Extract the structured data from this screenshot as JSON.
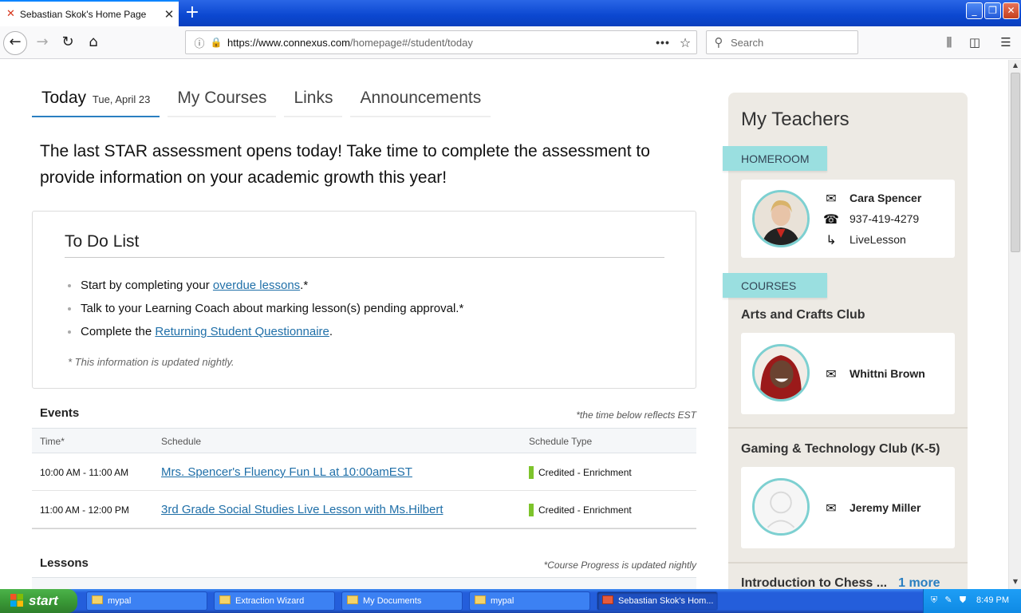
{
  "browser": {
    "tab_title": "Sebastian Skok's Home Page",
    "tab_close": "✕",
    "new_tab": "+",
    "url_host": "https://www.connexus.com",
    "url_path": "/homepage#/student/today",
    "url_menu": "•••",
    "search_placeholder": "Search",
    "icons": [
      "back-icon",
      "forward-icon",
      "reload-icon",
      "home-icon",
      "info-icon",
      "lock-icon",
      "star-icon",
      "search-icon",
      "library-icon",
      "sidebar-icon",
      "menu-icon"
    ]
  },
  "page_tabs": [
    {
      "label": "Today",
      "date": "Tue, April 23"
    },
    {
      "label": "My Courses"
    },
    {
      "label": "Links"
    },
    {
      "label": "Announcements"
    }
  ],
  "announcement": "The last STAR assessment opens today! Take time to complete the assessment to provide information on your academic growth this year!",
  "todo": {
    "title": "To Do List",
    "item1_prefix": "Start by completing your ",
    "item1_link": "overdue lessons",
    "item1_suffix": ".*",
    "item2": "Talk to your Learning Coach about marking lesson(s) pending approval.*",
    "item3_prefix": "Complete the ",
    "item3_link": "Returning Student Questionnaire",
    "item3_suffix": ".",
    "note": "* This information is updated nightly."
  },
  "events": {
    "title": "Events",
    "note": "*the time below reflects EST",
    "columns": [
      "Time*",
      "Schedule",
      "Schedule Type"
    ],
    "rows": [
      {
        "time": "10:00 AM - 11:00 AM",
        "schedule": "Mrs. Spencer's Fluency Fun LL at 10:00amEST",
        "type": "Credited - Enrichment"
      },
      {
        "time": "11:00 AM - 12:00 PM",
        "schedule": "3rd Grade Social Studies Live Lesson with Ms.Hilbert",
        "type": "Credited - Enrichment"
      }
    ],
    "type_color": "#7dc42b"
  },
  "lessons": {
    "title": "Lessons",
    "note": "*Course Progress is updated nightly"
  },
  "teachers": {
    "title": "My Teachers",
    "homeroom_label": "HOMEROOM",
    "homeroom": {
      "name": "Cara Spencer",
      "phone": "937-419-4279",
      "live": "LiveLesson"
    },
    "courses_label": "COURSES",
    "courses": [
      {
        "title": "Arts and Crafts Club",
        "teacher": "Whittni Brown"
      },
      {
        "title": "Gaming & Technology Club (K-5)",
        "teacher": "Jeremy Miller"
      },
      {
        "title": "Introduction to Chess ...",
        "more": "1 more"
      }
    ],
    "ribbon_color": "#9adfe0",
    "panel_color": "#edeae4"
  },
  "taskbar": {
    "start": "start",
    "tasks": [
      "mypal",
      "Extraction Wizard",
      "My Documents",
      "mypal",
      "Sebastian Skok's Hom..."
    ],
    "clock": "8:49 PM"
  }
}
